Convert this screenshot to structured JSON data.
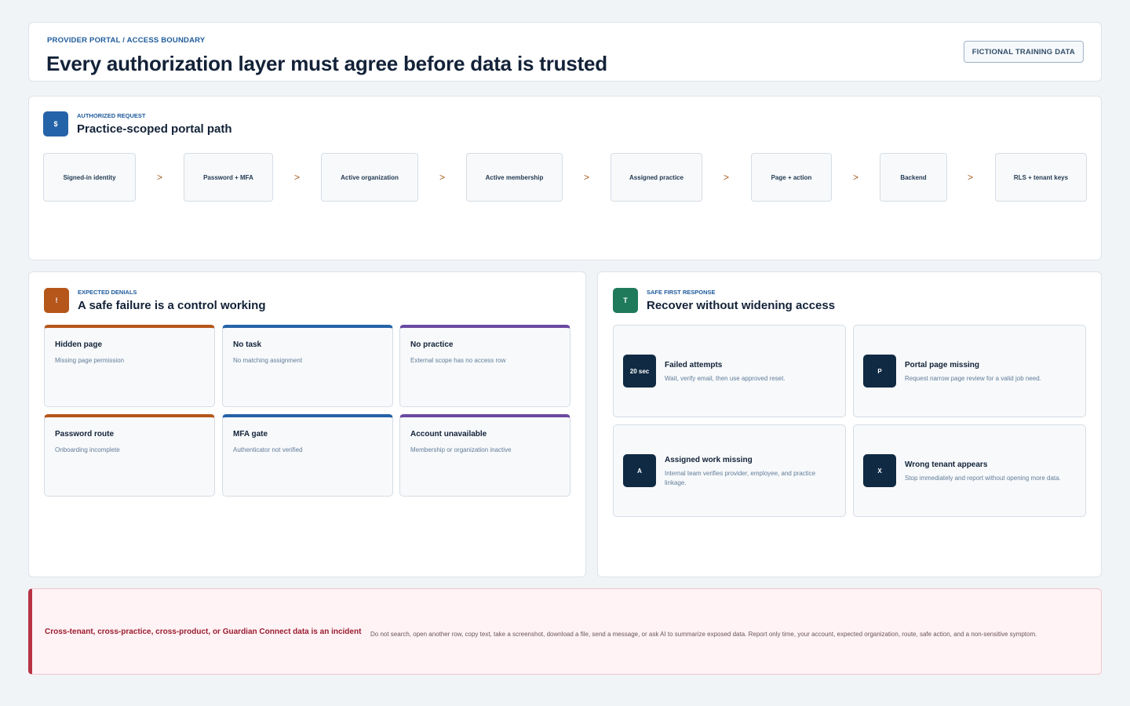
{
  "header": {
    "eyebrow": "PROVIDER PORTAL / ACCESS BOUNDARY",
    "title": "Every authorization layer must agree before data is trusted",
    "badge": "FICTIONAL TRAINING DATA"
  },
  "path_section": {
    "icon_glyph": "$",
    "eyebrow": "AUTHORIZED REQUEST",
    "title": "Practice-scoped portal path",
    "arrow_glyph": ">",
    "steps": [
      "Signed-in identity",
      "Password + MFA",
      "Active organization",
      "Active membership",
      "Assigned practice",
      "Page + action",
      "Backend",
      "RLS + tenant keys"
    ]
  },
  "denials_section": {
    "icon_glyph": "!",
    "eyebrow": "EXPECTED DENIALS",
    "title": "A safe failure is a control working",
    "tiles": [
      {
        "title": "Hidden page",
        "desc": "Missing page permission"
      },
      {
        "title": "No task",
        "desc": "No matching assignment"
      },
      {
        "title": "No practice",
        "desc": "External scope has no access row"
      },
      {
        "title": "Password route",
        "desc": "Onboarding incomplete"
      },
      {
        "title": "MFA gate",
        "desc": "Authenticator not verified"
      },
      {
        "title": "Account unavailable",
        "desc": "Membership or organization inactive"
      }
    ]
  },
  "recovery_section": {
    "icon_glyph": "T",
    "eyebrow": "SAFE FIRST RESPONSE",
    "title": "Recover without widening access",
    "tiles": [
      {
        "badge": "20 sec",
        "title": "Failed attempts",
        "desc": "Wait, verify email, then use approved reset."
      },
      {
        "badge": "P",
        "title": "Portal page missing",
        "desc": "Request narrow page review for a valid job need."
      },
      {
        "badge": "A",
        "title": "Assigned work missing",
        "desc": "Internal team verifies provider, employee, and practice linkage."
      },
      {
        "badge": "X",
        "title": "Wrong tenant appears",
        "desc": "Stop immediately and report without opening more data."
      }
    ]
  },
  "incident": {
    "title": "Cross-tenant, cross-practice, cross-product, or Guardian Connect data is an incident",
    "desc": "Do not search, open another row, copy text, take a screenshot, download a file, send a message, or ask AI to summarize exposed data. Report only time, your account, expected organization, route, safe action, and a non-sensitive symptom."
  },
  "colors": {
    "blue": "#2563a8",
    "orange": "#b5561b",
    "purple": "#6a4aa0",
    "green": "#1e7a5a",
    "navy": "#102a43",
    "incident_red": "#b83246"
  }
}
